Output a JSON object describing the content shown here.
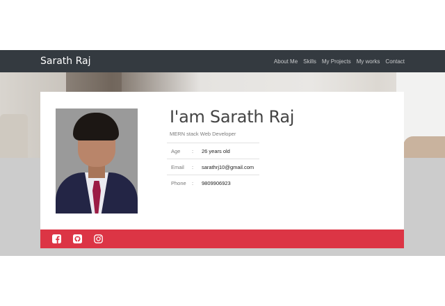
{
  "header": {
    "brand": "Sarath Raj",
    "nav": [
      "About Me",
      "Skills",
      "My Projects",
      "My works",
      "Contact"
    ]
  },
  "profile": {
    "name": "I'am Sarath Raj",
    "role": "MERN stack Web Developer",
    "details": [
      {
        "key": "Age",
        "sep": ":",
        "value": "26 years old"
      },
      {
        "key": "Email",
        "sep": ":",
        "value": "sarathrj10@gmail.com"
      },
      {
        "key": "Phone",
        "sep": ":",
        "value": "9809906923"
      }
    ]
  },
  "social": {
    "icons": [
      "facebook-icon",
      "github-icon",
      "instagram-icon"
    ]
  },
  "colors": {
    "navbar": "#343a40",
    "footer_bar": "#dc3545",
    "band": "#cccccc"
  }
}
